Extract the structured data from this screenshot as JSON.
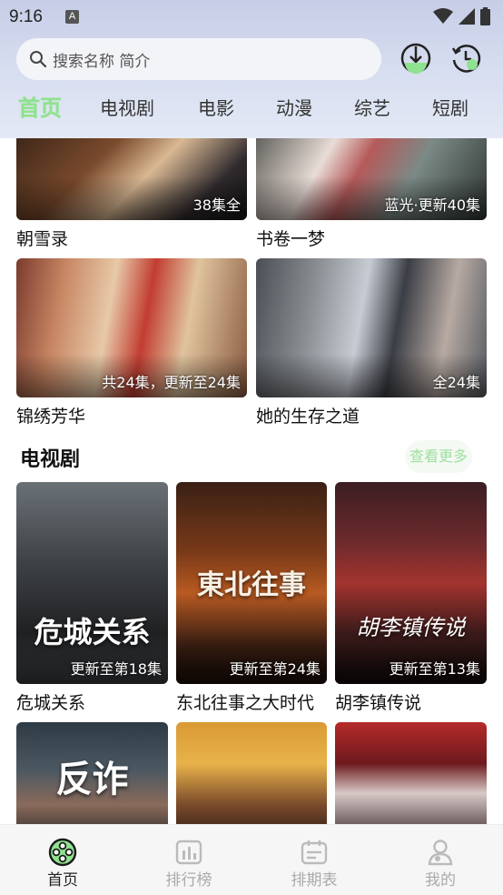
{
  "status": {
    "time": "9:16",
    "badge": "A"
  },
  "search": {
    "placeholder": "搜索名称 简介"
  },
  "tabs": [
    "首页",
    "电视剧",
    "电影",
    "动漫",
    "综艺",
    "短剧"
  ],
  "featured": [
    {
      "title": "朝雪录",
      "badge": "38集全"
    },
    {
      "title": "书卷一梦",
      "badge": "蓝光·更新40集"
    },
    {
      "title": "锦绣芳华",
      "badge": "共24集，更新至24集"
    },
    {
      "title": "她的生存之道",
      "badge": "全24集"
    }
  ],
  "section": {
    "title": "电视剧",
    "more": "查看更多"
  },
  "tv": [
    {
      "title": "危城关系",
      "badge": "更新至第18集",
      "poster_text": "危城关系"
    },
    {
      "title": "东北往事之大时代",
      "badge": "更新至第24集",
      "poster_text": "東北往事"
    },
    {
      "title": "胡李镇传说",
      "badge": "更新至第13集",
      "poster_text": "胡李镇传说"
    },
    {
      "poster_text": "反诈"
    }
  ],
  "nav": [
    "首页",
    "排行榜",
    "排期表",
    "我的"
  ],
  "colors": {
    "accent": "#8fe28f",
    "header_bg": "#d5dcef"
  }
}
